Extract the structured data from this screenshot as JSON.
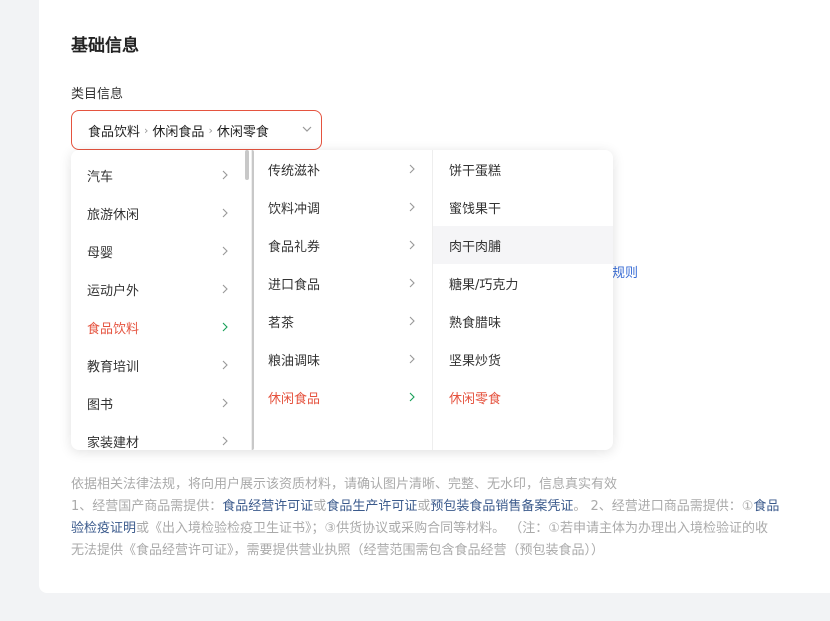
{
  "section": {
    "title": "基础信息"
  },
  "field": {
    "label": "类目信息"
  },
  "cascader": {
    "path": [
      "食品饮料",
      "休闲食品",
      "休闲零食"
    ],
    "separator": "›"
  },
  "behind_link": "规则",
  "dropdown": {
    "level1": [
      {
        "label": "汽车",
        "active": false
      },
      {
        "label": "旅游休闲",
        "active": false
      },
      {
        "label": "母婴",
        "active": false
      },
      {
        "label": "运动户外",
        "active": false
      },
      {
        "label": "食品饮料",
        "active": true
      },
      {
        "label": "教育培训",
        "active": false
      },
      {
        "label": "图书",
        "active": false
      },
      {
        "label": "家装建材",
        "active": false
      }
    ],
    "level2": [
      {
        "label": "传统滋补",
        "active": false
      },
      {
        "label": "饮料冲调",
        "active": false
      },
      {
        "label": "食品礼券",
        "active": false
      },
      {
        "label": "进口食品",
        "active": false
      },
      {
        "label": "茗茶",
        "active": false
      },
      {
        "label": "粮油调味",
        "active": false
      },
      {
        "label": "休闲食品",
        "active": true
      }
    ],
    "level3": [
      {
        "label": "饼干蛋糕",
        "active": false,
        "hover": false
      },
      {
        "label": "蜜饯果干",
        "active": false,
        "hover": false
      },
      {
        "label": "肉干肉脯",
        "active": false,
        "hover": true
      },
      {
        "label": "糖果/巧克力",
        "active": false,
        "hover": false
      },
      {
        "label": "熟食腊味",
        "active": false,
        "hover": false
      },
      {
        "label": "坚果炒货",
        "active": false,
        "hover": false
      },
      {
        "label": "休闲零食",
        "active": true,
        "hover": false
      }
    ]
  },
  "notes": {
    "line1": "依据相关法律法规，将向用户展示该资质材料，请确认图片清晰、完整、无水印，信息真实有效",
    "line2_a": "1、经营国产商品需提供：",
    "line2_b": "食品经营许可证",
    "line2_c": "或",
    "line2_d": "食品生产许可证",
    "line2_e": "或",
    "line2_f": "预包装食品销售备案凭证",
    "line2_g": "。 2、经营进口商品需提供：①",
    "line2_h": "食品",
    "line3_a": "验检疫证明",
    "line3_b": "或《出入境检验检疫卫生证书》；③供货协议或采购合同等材料。  （注：①若申请主体为办理出入境检验证的收",
    "line4": "无法提供《食品经营许可证》，需要提供营业执照（经营范围需包含食品经营（预包装食品））"
  },
  "colors": {
    "accent": "#e5533f",
    "link": "#3b5a8c",
    "arrow_active": "#18a058"
  }
}
